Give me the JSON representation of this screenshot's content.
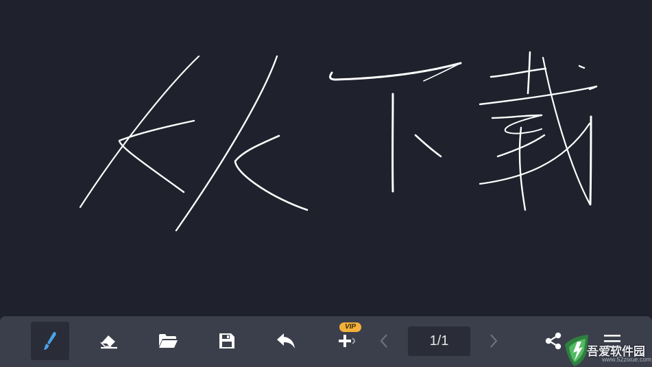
{
  "canvas": {
    "background": "#1f222c",
    "ink_color": "#ffffff"
  },
  "toolbar": {
    "background": "#3b3f4b",
    "accent": "#4aa3e8",
    "tools": [
      {
        "name": "brush-tool-button",
        "icon": "brush-icon",
        "active": true
      },
      {
        "name": "eraser-tool-button",
        "icon": "eraser-icon"
      },
      {
        "name": "open-folder-button",
        "icon": "folder-icon"
      },
      {
        "name": "save-button",
        "icon": "save-icon"
      },
      {
        "name": "undo-button",
        "icon": "undo-icon"
      },
      {
        "name": "add-page-button",
        "icon": "plus-icon"
      }
    ],
    "vip_label": "VIP",
    "page_indicator": "1/1",
    "share_icon": "share-icon",
    "menu_icon": "menu-icon"
  },
  "watermark": {
    "text": "吾爱软件园",
    "url": "www.52zixue.com"
  }
}
